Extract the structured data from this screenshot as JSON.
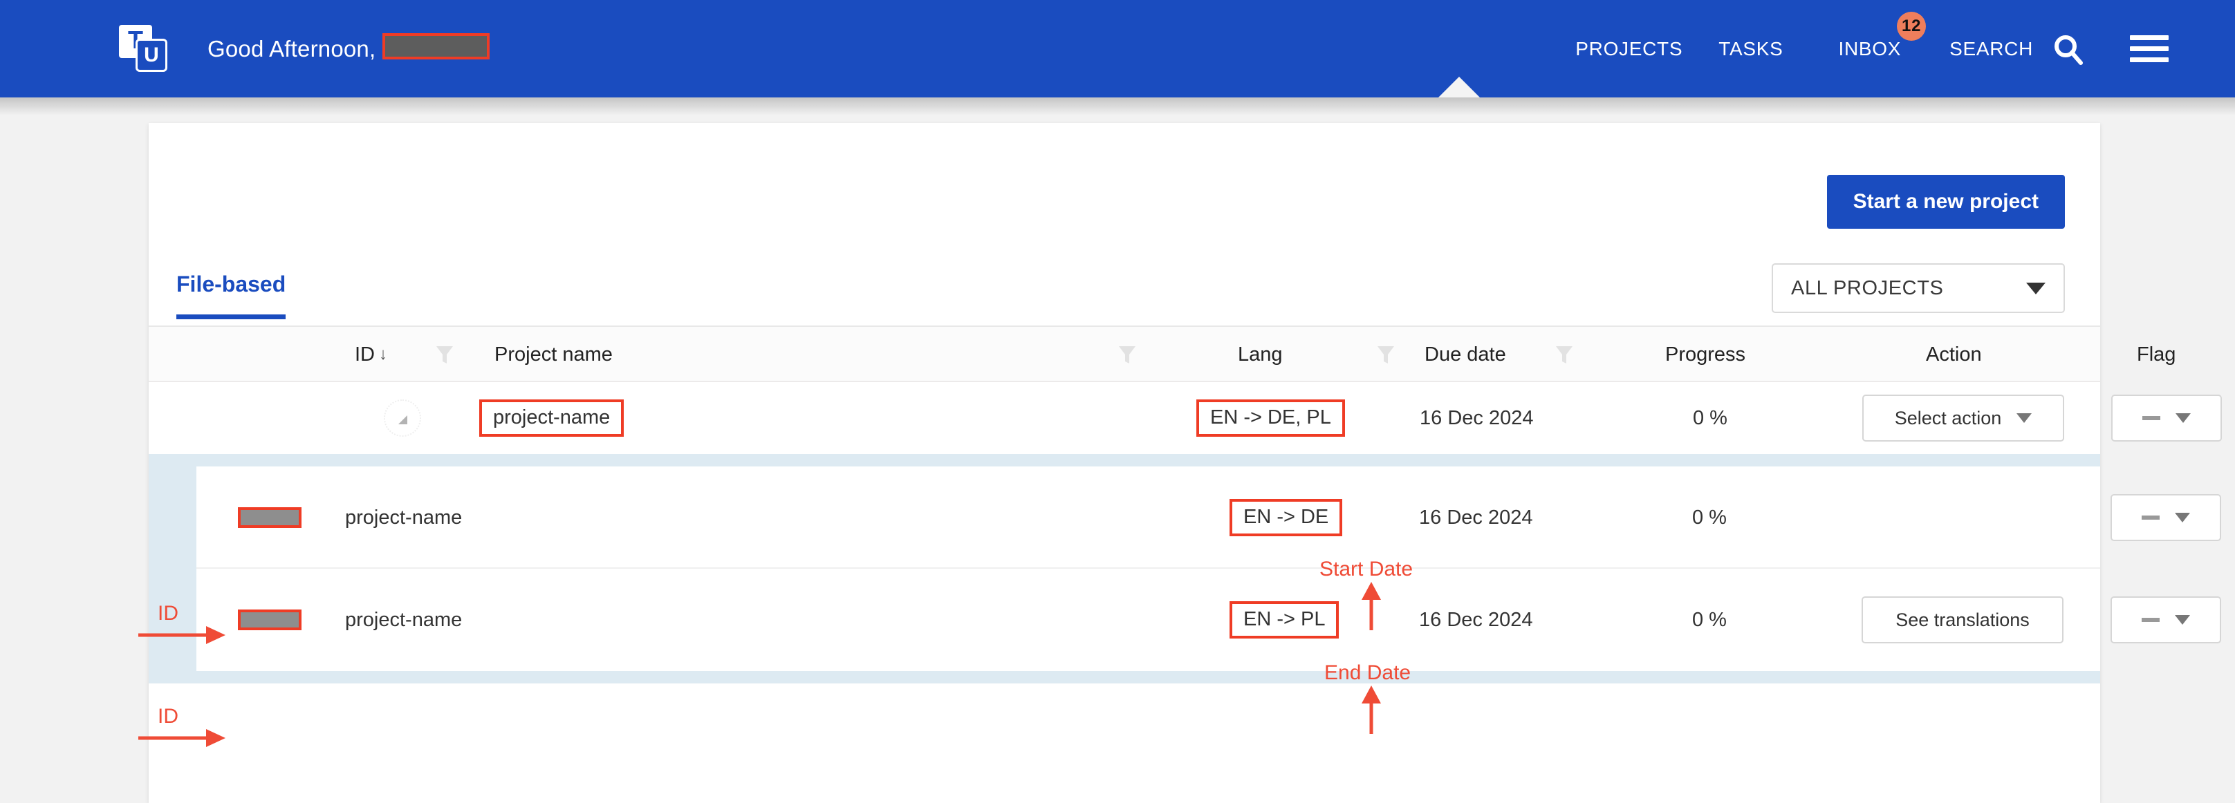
{
  "header": {
    "logo_t": "T",
    "logo_u": "U",
    "greeting": "Good Afternoon,",
    "nav": {
      "projects": "PROJECTS",
      "tasks": "TASKS",
      "inbox": "INBOX",
      "inbox_badge": "12",
      "search": "SEARCH"
    },
    "icons": {
      "search": "search-icon",
      "menu": "hamburger-menu-icon"
    },
    "colors": {
      "nav_background": "#1a4cbf",
      "badge": "#ef7e5c",
      "text": "#ffffff"
    }
  },
  "toolbar": {
    "new_project_label": "Start a new project"
  },
  "tabs": [
    {
      "label": "File-based",
      "active": true
    }
  ],
  "filter": {
    "selected": "ALL PROJECTS",
    "caret": "chevron-down-icon"
  },
  "table": {
    "columns": [
      {
        "key": "id",
        "label": "ID",
        "sorted": true,
        "sort_dir": "↓",
        "has_filter": true
      },
      {
        "key": "name",
        "label": "Project name",
        "sorted": false,
        "has_filter": true
      },
      {
        "key": "lang",
        "label": "Lang",
        "sorted": false,
        "has_filter": true
      },
      {
        "key": "due",
        "label": "Due date",
        "sorted": false,
        "has_filter": true
      },
      {
        "key": "progress",
        "label": "Progress",
        "sorted": false,
        "has_filter": false
      },
      {
        "key": "action",
        "label": "Action",
        "sorted": false,
        "has_filter": false
      },
      {
        "key": "flag",
        "label": "Flag",
        "sorted": false,
        "has_filter": false
      }
    ],
    "parent_row": {
      "expander": "collapse-triangle-icon",
      "id": "",
      "name": "project-name",
      "lang": "EN -> DE, PL",
      "due": "16 Dec 2024",
      "progress": "0 %",
      "action_label": "Select action",
      "flag_label": "—"
    },
    "sub_rows": [
      {
        "id": "",
        "name": "project-name",
        "lang": "EN -> DE",
        "due": "16 Dec 2024",
        "progress": "0 %",
        "action_label": "",
        "flag_label": "—"
      },
      {
        "id": "",
        "name": "project-name",
        "lang": "EN -> PL",
        "due": "16 Dec 2024",
        "progress": "0 %",
        "action_label": "See translations",
        "flag_label": "—"
      }
    ]
  },
  "annotations": {
    "start_date": "Start Date",
    "end_date": "End Date",
    "id_label_1": "ID",
    "id_label_2": "ID",
    "color": "#ef4b36"
  }
}
